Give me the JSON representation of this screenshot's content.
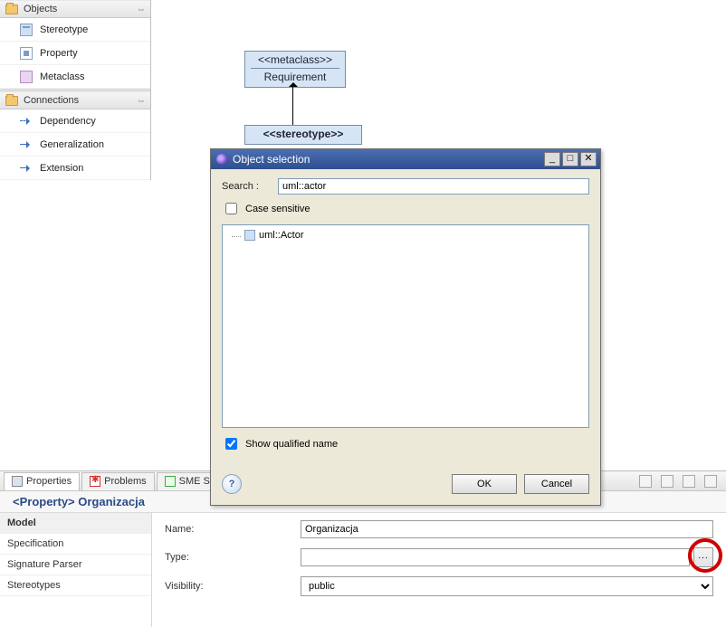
{
  "palette": {
    "sections": [
      {
        "title": "Objects",
        "expand": "⇔",
        "items": [
          {
            "label": "Stereotype",
            "icon": "stereotype-icon"
          },
          {
            "label": "Property",
            "icon": "property-icon"
          },
          {
            "label": "Metaclass",
            "icon": "metaclass-icon"
          }
        ]
      },
      {
        "title": "Connections",
        "expand": "⇔",
        "items": [
          {
            "label": "Dependency",
            "icon": "dependency-icon"
          },
          {
            "label": "Generalization",
            "icon": "generalization-icon"
          },
          {
            "label": "Extension",
            "icon": "extension-icon"
          }
        ]
      }
    ]
  },
  "diagram": {
    "metaclass": {
      "stereo": "<<metaclass>>",
      "name": "Requirement"
    },
    "stereotype": {
      "stereo": "<<stereotype>>"
    }
  },
  "dialog": {
    "title": "Object selection",
    "search_label": "Search :",
    "search_value": "uml::actor",
    "case_label": "Case sensitive",
    "case_checked": false,
    "tree": [
      {
        "label": "uml::Actor"
      }
    ],
    "qualified_label": "Show qualified name",
    "qualified_checked": true,
    "ok": "OK",
    "cancel": "Cancel",
    "help": "?",
    "win": {
      "min": "_",
      "max": "□",
      "close": "✕"
    }
  },
  "tabs": {
    "items": [
      {
        "label": "Properties",
        "active": true
      },
      {
        "label": "Problems",
        "active": false
      },
      {
        "label": "SME S",
        "active": false
      }
    ]
  },
  "header": {
    "text": "<Property> Organizacja"
  },
  "categories": [
    {
      "label": "Model",
      "active": true
    },
    {
      "label": "Specification",
      "active": false
    },
    {
      "label": "Signature Parser",
      "active": false
    },
    {
      "label": "Stereotypes",
      "active": false
    }
  ],
  "fields": {
    "name_label": "Name:",
    "name_value": "Organizacja",
    "type_label": "Type:",
    "type_value": "",
    "type_button": "...",
    "visibility_label": "Visibility:",
    "visibility_value": "public"
  }
}
